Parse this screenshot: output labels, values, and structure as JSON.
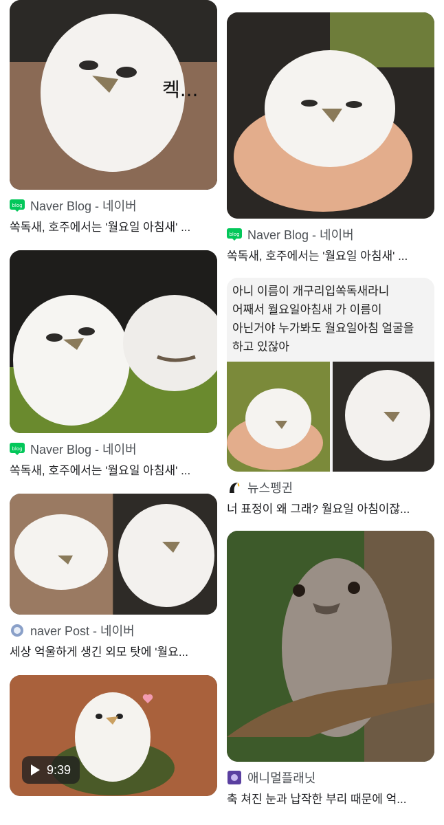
{
  "results": {
    "left": [
      {
        "source": "Naver Blog - 네이버",
        "title": "쏙독새, 호주에서는 '월요일 아침새' ...",
        "icon": "naver-blog-icon",
        "overlay_text": "켁..."
      },
      {
        "source": "Naver Blog - 네이버",
        "title": "쏙독새, 호주에서는 '월요일 아침새' ...",
        "icon": "naver-blog-icon"
      },
      {
        "source": "naver Post - 네이버",
        "title": "세상 억울하게 생긴 외모 탓에 '월요...",
        "icon": "naver-post-icon"
      },
      {
        "duration": "9:39"
      }
    ],
    "right": [
      {
        "source": "Naver Blog - 네이버",
        "title": "쏙독새, 호주에서는 '월요일 아침새' ...",
        "icon": "naver-blog-icon"
      },
      {
        "source": "뉴스펭귄",
        "title": "너 표정이 왜 그래? 월요일 아침이잖...",
        "icon": "newspenguin-icon",
        "panel_lines": [
          "아니 이름이 개구리입쏙독새라니",
          "어째서 월요일아침새 가 이름이",
          "아닌거야 누가봐도 월요일아침 얼굴을",
          "하고 있잖아"
        ]
      },
      {
        "source": "애니멀플래닛",
        "title": "축 쳐진 눈과 납작한 부리 때문에 억...",
        "icon": "animal-planet-icon"
      }
    ]
  },
  "colors": {
    "blog_green": "#03c75a",
    "text": "#202124",
    "muted": "#4d5156"
  }
}
